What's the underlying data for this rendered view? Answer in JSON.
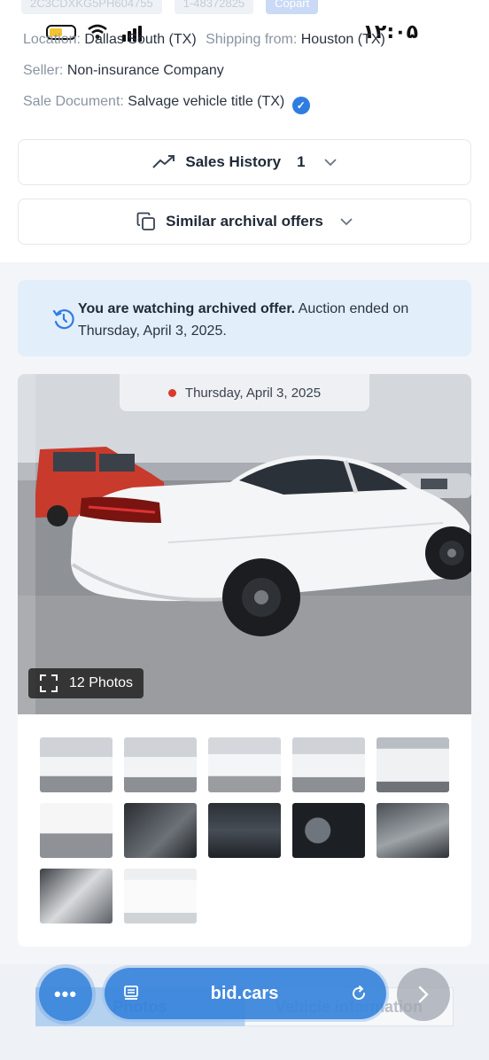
{
  "header": {
    "ghost_texts": [
      "2C3CDXKG5PH604755",
      "1-48372825",
      "Copart"
    ],
    "status_bar": {
      "time": "۱۲:۰۵"
    }
  },
  "vehicle_info": {
    "location_label": "Location:",
    "location_value": "Dallas South (TX)",
    "shipping_label": "Shipping from:",
    "shipping_value": "Houston (TX)",
    "seller_label": "Seller:",
    "seller_value": "Non-insurance Company",
    "document_label": "Sale Document:",
    "document_value": "Salvage vehicle title (TX)"
  },
  "sales_history": {
    "label": "Sales History",
    "count": "1"
  },
  "similar_offers": {
    "label": "Similar archival offers"
  },
  "notice": {
    "bold_text": "You are watching archived offer.",
    "text": " Auction ended on Thursday, April 3, 2025."
  },
  "gallery": {
    "date": "Thursday, April 3, 2025",
    "photos_label": "12 Photos",
    "thumbnail_count": 12
  },
  "bottom_bar": {
    "url": "bid.cars",
    "faded_tab_1": "Photos",
    "faded_tab_2": "Vehicle information"
  },
  "colors": {
    "accent": "#2f7de1",
    "notice_bg": "#e3eefb",
    "status_dot": "#d93a2b"
  }
}
